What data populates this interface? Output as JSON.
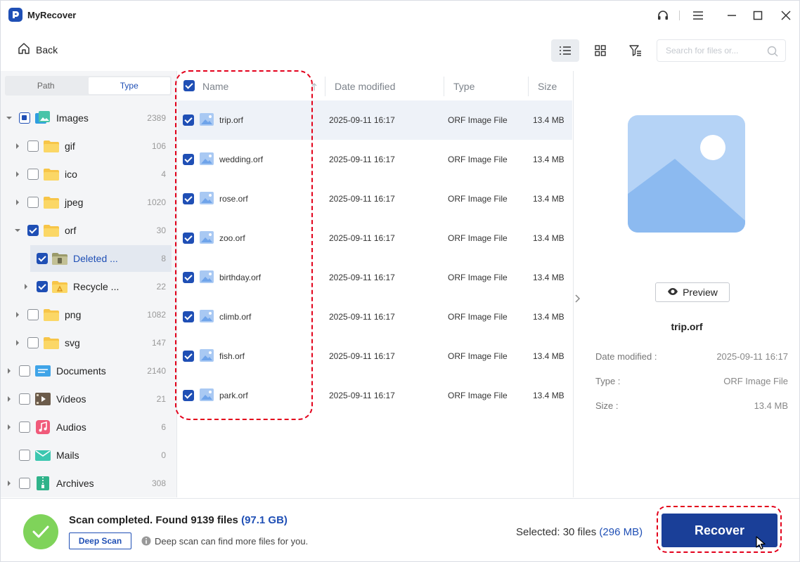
{
  "app": {
    "title": "MyRecover"
  },
  "colors": {
    "accent": "#1f4fb5",
    "recover_button": "#1a3f98",
    "success": "#7fd35a",
    "annotation": "#e3001b"
  },
  "toolbar": {
    "back_label": "Back",
    "search_placeholder": "Search for files or...",
    "icons": [
      "list-view-icon",
      "grid-view-icon",
      "filter-icon",
      "search-icon"
    ]
  },
  "sidebar": {
    "tabs": [
      {
        "label": "Path"
      },
      {
        "label": "Type"
      }
    ],
    "active_tab": "Type",
    "items": [
      {
        "label": "Images",
        "count": "2389",
        "state": "partial",
        "icon": "images-icon"
      },
      {
        "label": "gif",
        "count": "106",
        "state": "unchecked",
        "icon": "folder-icon"
      },
      {
        "label": "ico",
        "count": "4",
        "state": "unchecked",
        "icon": "folder-icon"
      },
      {
        "label": "jpeg",
        "count": "1020",
        "state": "unchecked",
        "icon": "folder-icon"
      },
      {
        "label": "orf",
        "count": "30",
        "state": "checked",
        "icon": "folder-icon"
      },
      {
        "label": "Deleted ...",
        "count": "8",
        "state": "checked",
        "icon": "deleted-folder-icon"
      },
      {
        "label": "Recycle ...",
        "count": "22",
        "state": "checked",
        "icon": "recycle-folder-icon"
      },
      {
        "label": "png",
        "count": "1082",
        "state": "unchecked",
        "icon": "folder-icon"
      },
      {
        "label": "svg",
        "count": "147",
        "state": "unchecked",
        "icon": "folder-icon"
      },
      {
        "label": "Documents",
        "count": "2140",
        "state": "unchecked",
        "icon": "documents-icon"
      },
      {
        "label": "Videos",
        "count": "21",
        "state": "unchecked",
        "icon": "videos-icon"
      },
      {
        "label": "Audios",
        "count": "6",
        "state": "unchecked",
        "icon": "audios-icon"
      },
      {
        "label": "Mails",
        "count": "0",
        "state": "unchecked",
        "icon": "mails-icon"
      },
      {
        "label": "Archives",
        "count": "308",
        "state": "unchecked",
        "icon": "archives-icon"
      }
    ]
  },
  "file_list": {
    "columns": {
      "name": "Name",
      "date": "Date modified",
      "type": "Type",
      "size": "Size"
    },
    "rows": [
      {
        "name": "trip.orf",
        "date": "2025-09-11 16:17",
        "type": "ORF Image File",
        "size": "13.4 MB"
      },
      {
        "name": "wedding.orf",
        "date": "2025-09-11 16:17",
        "type": "ORF Image File",
        "size": "13.4 MB"
      },
      {
        "name": "rose.orf",
        "date": "2025-09-11 16:17",
        "type": "ORF Image File",
        "size": "13.4 MB"
      },
      {
        "name": "zoo.orf",
        "date": "2025-09-11 16:17",
        "type": "ORF Image File",
        "size": "13.4 MB"
      },
      {
        "name": "birthday.orf",
        "date": "2025-09-11 16:17",
        "type": "ORF Image File",
        "size": "13.4 MB"
      },
      {
        "name": "climb.orf",
        "date": "2025-09-11 16:17",
        "type": "ORF Image File",
        "size": "13.4 MB"
      },
      {
        "name": "fish.orf",
        "date": "2025-09-11 16:17",
        "type": "ORF Image File",
        "size": "13.4 MB"
      },
      {
        "name": "park.orf",
        "date": "2025-09-11 16:17",
        "type": "ORF Image File",
        "size": "13.4 MB"
      }
    ]
  },
  "preview": {
    "button_label": "Preview",
    "file_name": "trip.orf",
    "details": [
      {
        "label": "Date modified :",
        "value": "2025-09-11 16:17"
      },
      {
        "label": "Type :",
        "value": "ORF Image File"
      },
      {
        "label": "Size :",
        "value": "13.4 MB"
      }
    ]
  },
  "status": {
    "scan_prefix": "Scan completed. Found 9139 files",
    "scan_size": "(97.1 GB)",
    "deep_scan_label": "Deep Scan",
    "deep_scan_hint": "Deep scan can find more files for you.",
    "selected_prefix": "Selected: 30 files",
    "selected_size": "(296 MB)",
    "recover_label": "Recover"
  }
}
